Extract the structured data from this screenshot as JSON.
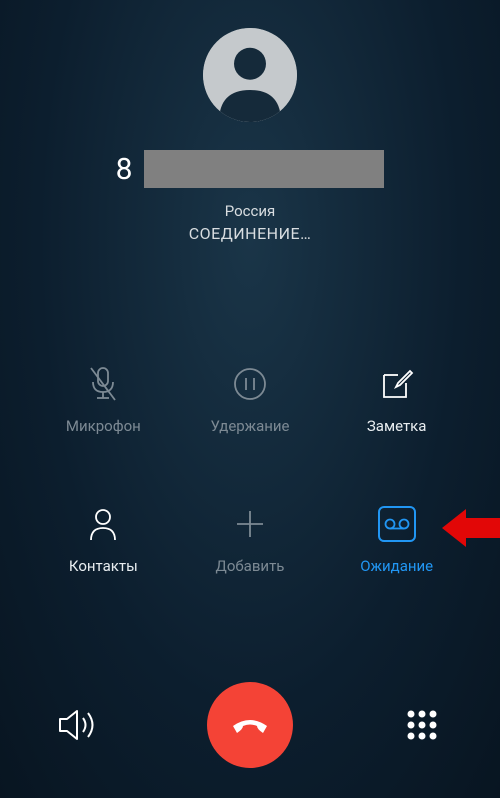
{
  "call": {
    "number_prefix": "8",
    "country": "Россия",
    "status": "СОЕДИНЕНИЕ…"
  },
  "actions": {
    "mute": "Микрофон",
    "hold": "Удержание",
    "note": "Заметка",
    "contacts": "Контакты",
    "add": "Добавить",
    "wait": "Ожидание"
  }
}
